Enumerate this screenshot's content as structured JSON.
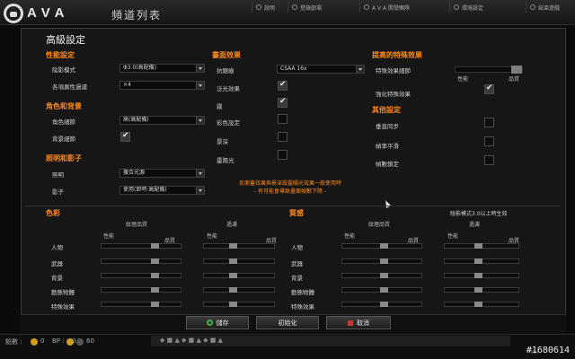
{
  "app": {
    "logo_text": "AVA",
    "window_title": "頻道列表",
    "top_nav": [
      "說明",
      "登錄劇場",
      "A V A 開發團隊",
      "環境設定",
      "結束遊戲"
    ]
  },
  "dialog": {
    "title": "高級設定",
    "performance": {
      "title": "性能設定",
      "shader_mode_label": "陰影模式",
      "shader_mode_value": "Φ3.0(高配備)",
      "anisotropic_label": "各項異性過濾",
      "anisotropic_value": "×4"
    },
    "character_bg": {
      "title": "角色和背景",
      "char_detail_label": "角色細節",
      "char_detail_value": "高(高配備)",
      "bg_detail_label": "背景細節",
      "bg_detail_checked": true
    },
    "light_shadow": {
      "title": "照明和影子",
      "lighting_label": "照明",
      "lighting_value": "複合光源",
      "shadow_label": "影子",
      "shadow_value": "使用(即時:高配備)"
    },
    "graphics": {
      "title": "畫面效果",
      "aa_label": "抗鋸齒",
      "aa_value": "CSAA 16x",
      "items": [
        {
          "label": "泛光效果",
          "checked": true
        },
        {
          "label": "霧",
          "checked": true
        },
        {
          "label": "彩色設定",
          "checked": false
        },
        {
          "label": "景深",
          "checked": false
        },
        {
          "label": "靈陽光",
          "checked": false
        }
      ],
      "warning_line1": "反面蓋效果與景深設靈陽光效果一般使用時",
      "warning_line2": "- 有可能會導致畫面幀數下降 -"
    },
    "enhanced": {
      "title": "提高的特殊效果",
      "detail_label": "特殊效果細節",
      "perf_label": "性能",
      "quality_label": "品質",
      "detail_level": 1.0,
      "enhance_label": "強化特殊效果",
      "enhance_checked": true
    },
    "other": {
      "title": "其他設定",
      "items": [
        {
          "label": "垂直同步",
          "checked": false
        },
        {
          "label": "幀率平滑",
          "checked": false
        },
        {
          "label": "幀數鎖定",
          "checked": false
        }
      ]
    },
    "color": {
      "title": "色彩",
      "texture_quality": "紋理品質",
      "filter": "過濾",
      "perf": "性能",
      "quality": "品質",
      "rows": [
        "人物",
        "武器",
        "背景",
        "動態物體",
        "特殊效果"
      ]
    },
    "texture": {
      "title": "質感",
      "note": "陰影模式3.0以上時生效",
      "texture_quality": "紋理品質",
      "filter": "過濾",
      "perf": "性能",
      "quality": "品質",
      "rows": [
        "人物",
        "武器",
        "背景",
        "動態物體",
        "特殊效果"
      ]
    },
    "buttons": {
      "save": "儲存",
      "reset": "初始化",
      "cancel": "取消"
    }
  },
  "status_bar": {
    "points_label": "點數 :",
    "points_value": "0",
    "bp_label": "BP :",
    "bp_value": "0",
    "eu_value": "60",
    "ad_text": "◆ ■ ▲ ◆ ■ ▲ ◆ ■ ▲",
    "version_label": "Ver",
    "watermark": "#1680614"
  }
}
